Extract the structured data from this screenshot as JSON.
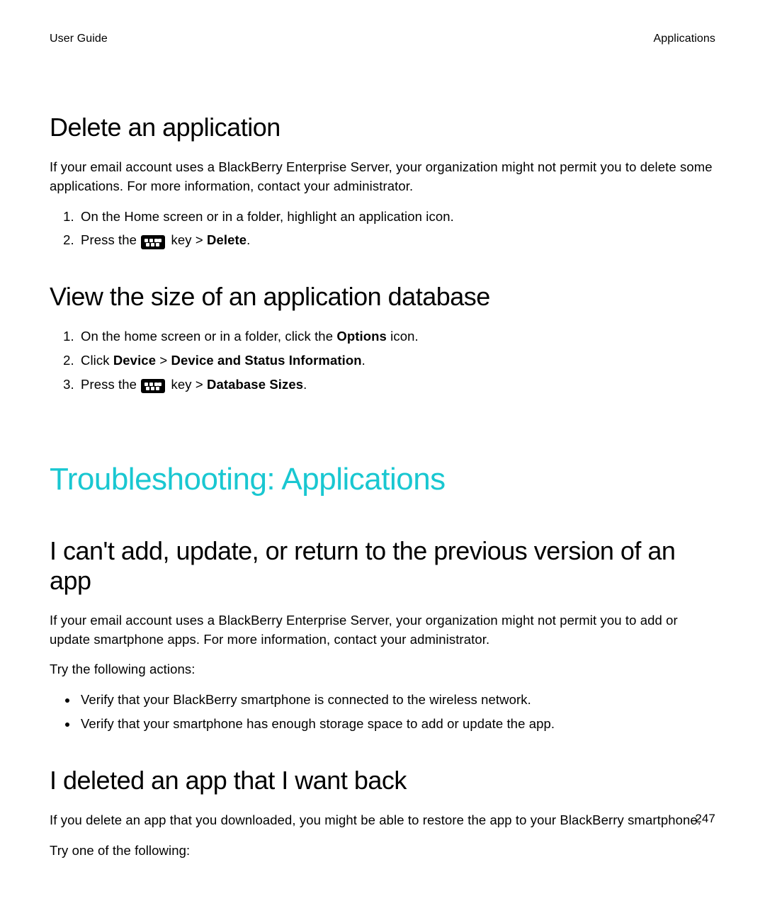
{
  "header": {
    "left": "User Guide",
    "right": "Applications"
  },
  "sec_delete": {
    "title": "Delete an application",
    "intro": "If your email account uses a BlackBerry Enterprise Server, your organization might not permit you to delete some applications. For more information, contact your administrator.",
    "steps": {
      "s1": "On the Home screen or in a folder, highlight an application icon.",
      "s2_pre": "Press the ",
      "s2_mid": " key > ",
      "s2_bold": "Delete",
      "s2_post": "."
    }
  },
  "sec_view": {
    "title": "View the size of an application database",
    "steps": {
      "s1_pre": "On the home screen or in a folder, click the ",
      "s1_bold": "Options",
      "s1_post": " icon.",
      "s2_pre": "Click ",
      "s2_b1": "Device",
      "s2_mid": " > ",
      "s2_b2": "Device and Status Information",
      "s2_post": ".",
      "s3_pre": "Press the ",
      "s3_mid": " key > ",
      "s3_bold": "Database Sizes",
      "s3_post": "."
    }
  },
  "trouble_heading": "Troubleshooting: Applications",
  "sec_cant": {
    "title": "I can't add, update, or return to the previous version of an app",
    "intro": "If your email account uses a BlackBerry Enterprise Server, your organization might not permit you to add or update smartphone apps. For more information, contact your administrator.",
    "try": "Try the following actions:",
    "bullets": {
      "b1": "Verify that your BlackBerry smartphone is connected to the wireless network.",
      "b2": "Verify that your smartphone has enough storage space to add or update the app."
    }
  },
  "sec_deleted": {
    "title": "I deleted an app that I want back",
    "p1": "If you delete an app that you downloaded, you might be able to restore the app to your BlackBerry smartphone.",
    "p2": "Try one of the following:"
  },
  "page_number": "247"
}
